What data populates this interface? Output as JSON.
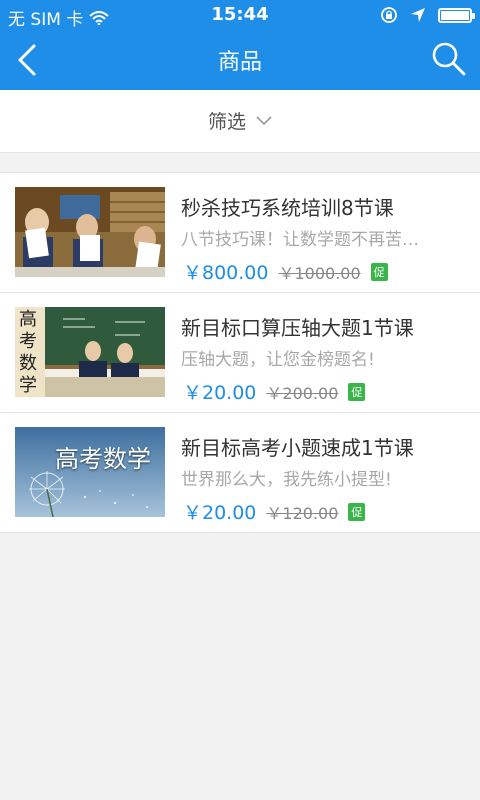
{
  "status_bar": {
    "carrier": "无 SIM 卡",
    "time": "15:44"
  },
  "nav": {
    "title": "商品"
  },
  "filter": {
    "label": "筛选"
  },
  "products": [
    {
      "title": "秒杀技巧系统培训8节课",
      "description": "八节技巧课！让数学题不再苦…",
      "price": "￥800.00",
      "original_price": "￥1000.00",
      "tag": "促",
      "thumb_text": ""
    },
    {
      "title": "新目标口算压轴大题1节课",
      "description": "压轴大题，让您金榜题名!",
      "price": "￥20.00",
      "original_price": "￥200.00",
      "tag": "促",
      "thumb_text": "高考数学"
    },
    {
      "title": "新目标高考小题速成1节课",
      "description": "世界那么大，我先练小提型!",
      "price": "￥20.00",
      "original_price": "￥120.00",
      "tag": "促",
      "thumb_text": "高考数学"
    }
  ],
  "colors": {
    "primary": "#1f8ee8",
    "promo": "#3ab54a"
  }
}
